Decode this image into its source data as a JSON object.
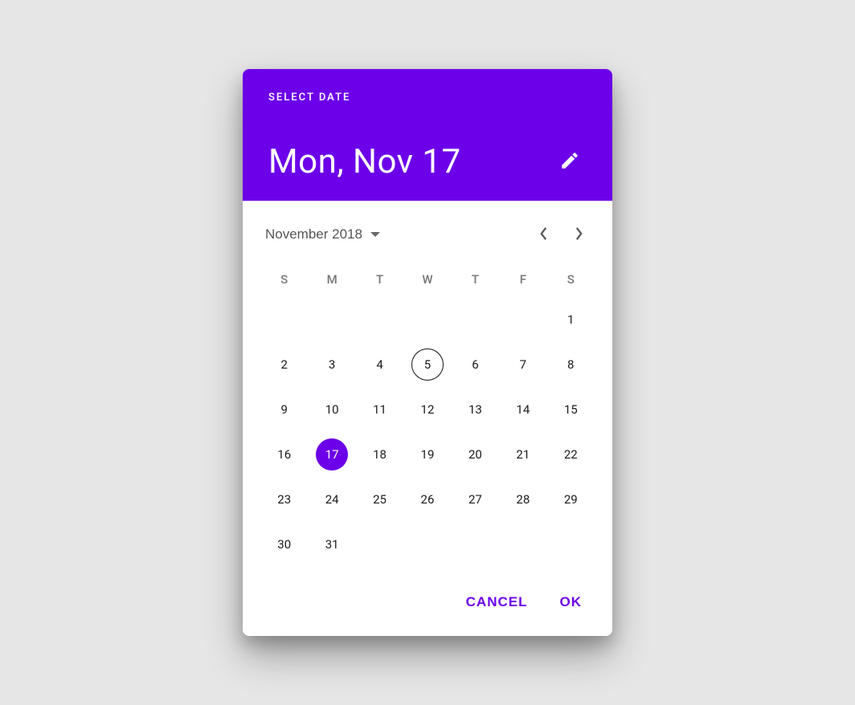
{
  "header": {
    "supertitle": "SELECT DATE",
    "title": "Mon, Nov 17"
  },
  "controls": {
    "month_label": "November 2018"
  },
  "days_of_week": [
    "S",
    "M",
    "T",
    "W",
    "T",
    "F",
    "S"
  ],
  "calendar": {
    "leading_blanks": 6,
    "days_in_month": 31,
    "today": 5,
    "selected": 17
  },
  "actions": {
    "cancel": "CANCEL",
    "ok": "OK"
  },
  "colors": {
    "accent": "#6c00e9"
  }
}
